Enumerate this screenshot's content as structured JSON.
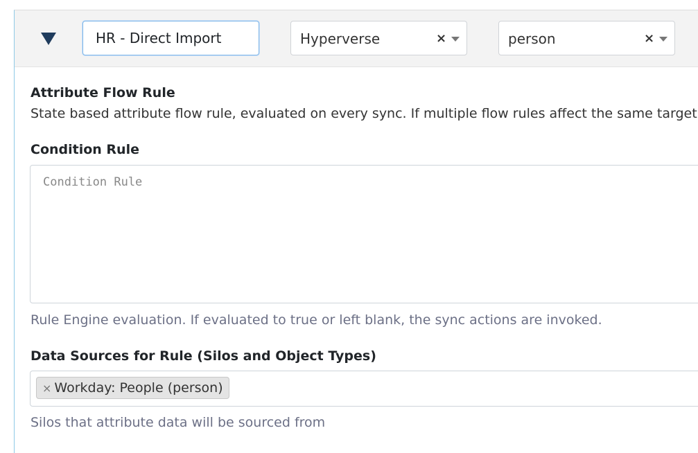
{
  "header": {
    "name_value": "HR - Direct Import",
    "silo_select": {
      "value": "Hyperverse",
      "clear": "×"
    },
    "type_select": {
      "value": "person",
      "clear": "×"
    }
  },
  "attribute_flow": {
    "title": "Attribute Flow Rule",
    "description": "State based attribute flow rule, evaluated on every sync. If multiple flow rules affect the same target only"
  },
  "condition_rule": {
    "label": "Condition Rule",
    "placeholder": "Condition Rule",
    "help": "Rule Engine evaluation. If evaluated to true or left blank, the sync actions are invoked."
  },
  "data_sources": {
    "label": "Data Sources for Rule (Silos and Object Types)",
    "tags": [
      {
        "remove": "×",
        "label": "Workday: People (person)"
      }
    ],
    "help": "Silos that attribute data will be sourced from"
  },
  "colors": {
    "accent_border": "#8ec9e6",
    "focus_border": "#7fb6e8",
    "help_text": "#6c7086"
  }
}
